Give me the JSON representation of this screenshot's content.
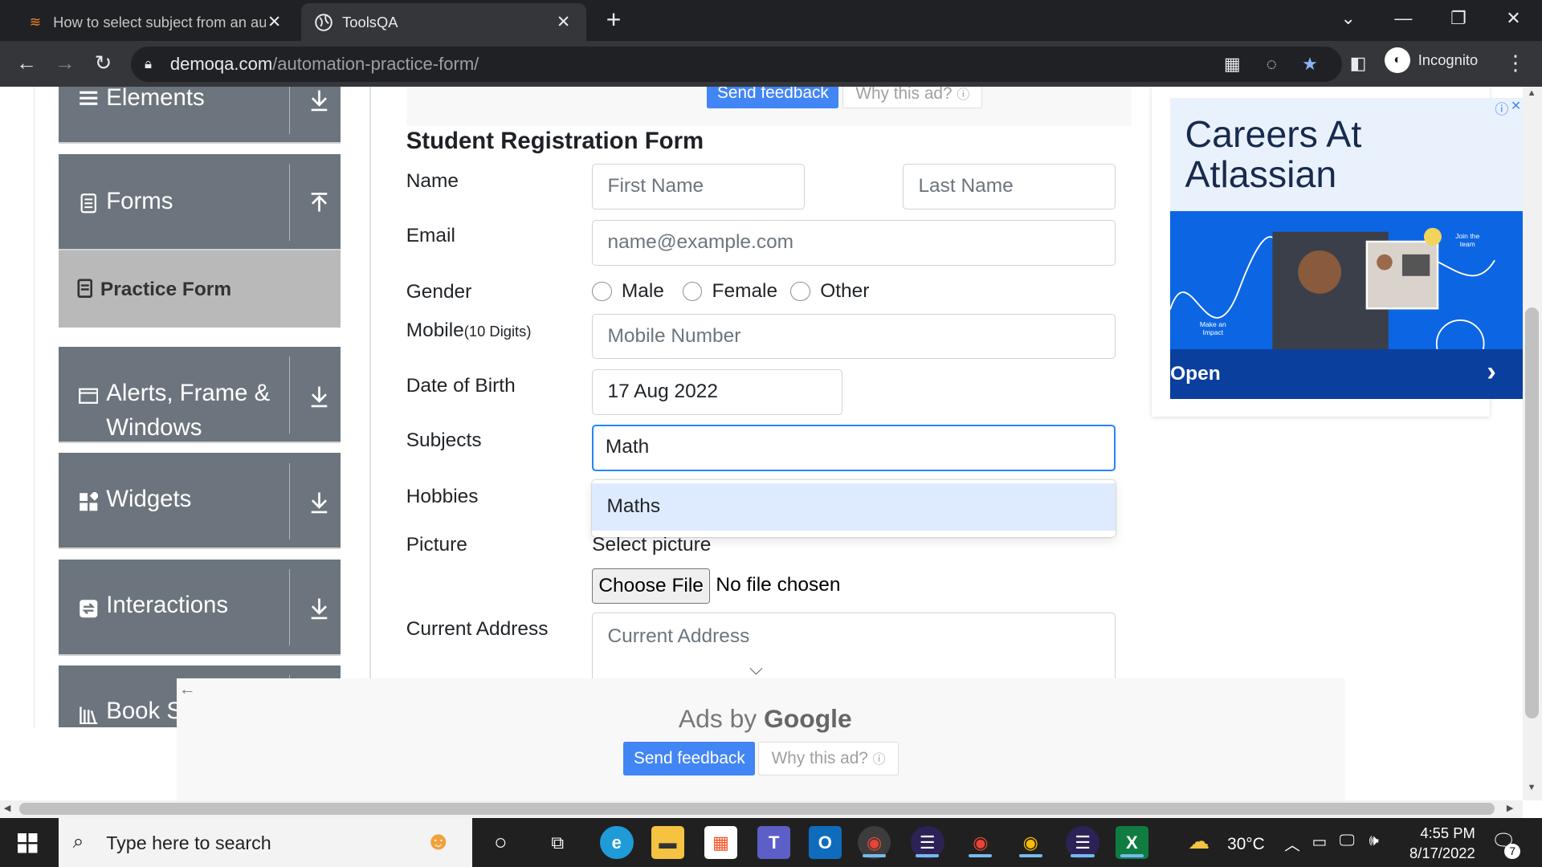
{
  "browser": {
    "tabs": [
      {
        "title": "How to select subject from an au"
      },
      {
        "title": "ToolsQA"
      }
    ],
    "url_host": "demoqa.com",
    "url_path": "/automation-practice-form/",
    "profile_label": "Incognito"
  },
  "sidebar": {
    "groups": [
      {
        "label": "Elements",
        "icon": "menu-icon",
        "arrow": "download-arrow-icon"
      },
      {
        "label": "Forms",
        "icon": "document-icon",
        "arrow": "upload-arrow-icon"
      },
      {
        "label": "Alerts, Frame &",
        "label2": "Windows",
        "icon": "window-icon",
        "arrow": "download-arrow-icon"
      },
      {
        "label": "Widgets",
        "icon": "widgets-icon",
        "arrow": "download-arrow-icon"
      },
      {
        "label": "Interactions",
        "icon": "interactions-icon",
        "arrow": "download-arrow-icon"
      },
      {
        "label": "Book S",
        "icon": "books-icon"
      }
    ],
    "active_item": "Practice Form"
  },
  "ad_top": {
    "send_feedback": "Send feedback",
    "why": "Why this ad?"
  },
  "form": {
    "title": "Student Registration Form",
    "labels": {
      "name": "Name",
      "email": "Email",
      "gender": "Gender",
      "mobile": "Mobile",
      "mobile_hint": "(10 Digits)",
      "dob": "Date of Birth",
      "subjects": "Subjects",
      "hobbies": "Hobbies",
      "picture": "Picture",
      "address": "Current Address"
    },
    "placeholders": {
      "first_name": "First Name",
      "last_name": "Last Name",
      "email": "name@example.com",
      "mobile": "Mobile Number",
      "address": "Current Address"
    },
    "gender_options": [
      "Male",
      "Female",
      "Other"
    ],
    "dob_value": "17 Aug 2022",
    "subjects_value": "Math",
    "subject_suggestion": "Maths",
    "select_picture": "Select picture",
    "choose_file": "Choose File",
    "no_file": "No file chosen"
  },
  "ad_right": {
    "headline_1": "Careers At",
    "headline_2": "Atlassian",
    "cta": "Open",
    "img_text_1": "Join the",
    "img_text_2": "team",
    "img_text_3": "Make an",
    "img_text_4": "Impact"
  },
  "ad_bottom": {
    "ads_by": "Ads by",
    "google": "Google",
    "send_feedback": "Send feedback",
    "why": "Why this ad?"
  },
  "taskbar": {
    "search_placeholder": "Type here to search",
    "temperature": "30°C",
    "time": "4:55 PM",
    "date": "8/17/2022",
    "notification_count": "7"
  },
  "colors": {
    "sidebar_group": "#6c757d",
    "focus_border": "#2684ff",
    "option_highlight": "#deebff",
    "send_feedback": "#4285f4"
  }
}
